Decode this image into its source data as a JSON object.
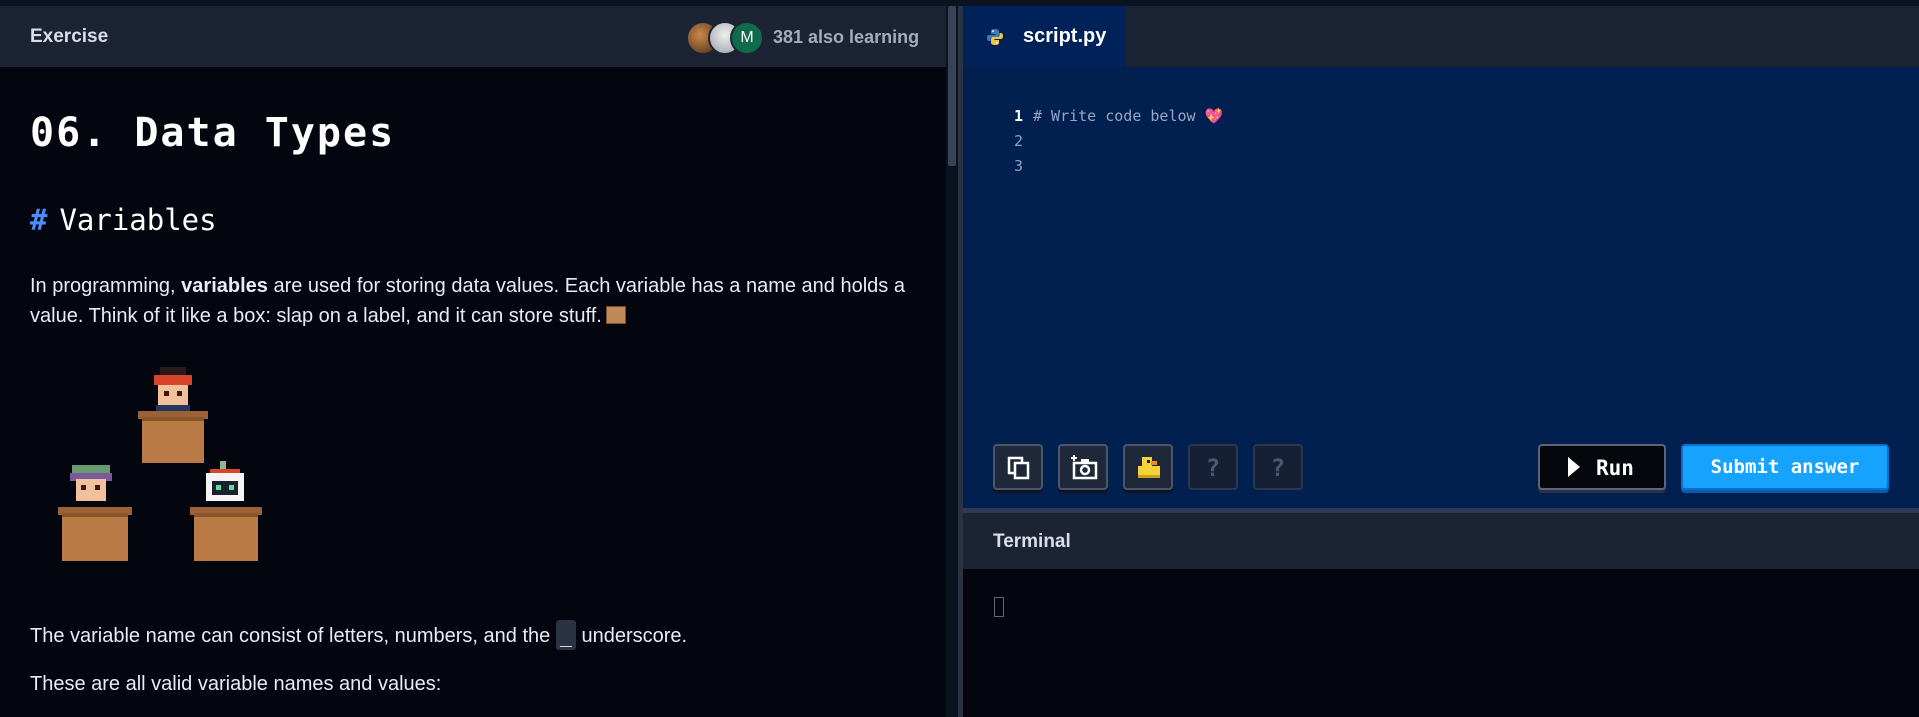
{
  "exercise_panel": {
    "header_title": "Exercise",
    "avatar_initial": "M",
    "learning_count": "381 also learning"
  },
  "lesson": {
    "title": "06. Data Types",
    "section_hash": "#",
    "section_title": "Variables",
    "p1_intro": "In programming, ",
    "p1_bold": "variables",
    "p1_rest": " are used for storing data values. Each variable has a name and holds a value. Think of it like a box: slap on a label, and it can store stuff.",
    "p2_before": "The variable name can consist of letters, numbers, and the ",
    "p2_code": "_",
    "p2_after": " underscore.",
    "p3": "These are all valid variable names and values:"
  },
  "editor": {
    "tab_label": "script.py",
    "line_numbers": [
      "1",
      "2",
      "3"
    ],
    "line1_text": "# Write code below 💖",
    "tools": [
      "copy-icon",
      "screenshot-icon",
      "rubber-duck-icon",
      "help-icon",
      "help-icon"
    ],
    "help_glyph": "?",
    "run_label": "Run",
    "submit_label": "Submit answer"
  },
  "terminal": {
    "title": "Terminal"
  },
  "colors": {
    "accent": "#16a3ff",
    "editor_bg": "#01204f",
    "header_bg": "#1c2433",
    "hash": "#4c8dff"
  }
}
